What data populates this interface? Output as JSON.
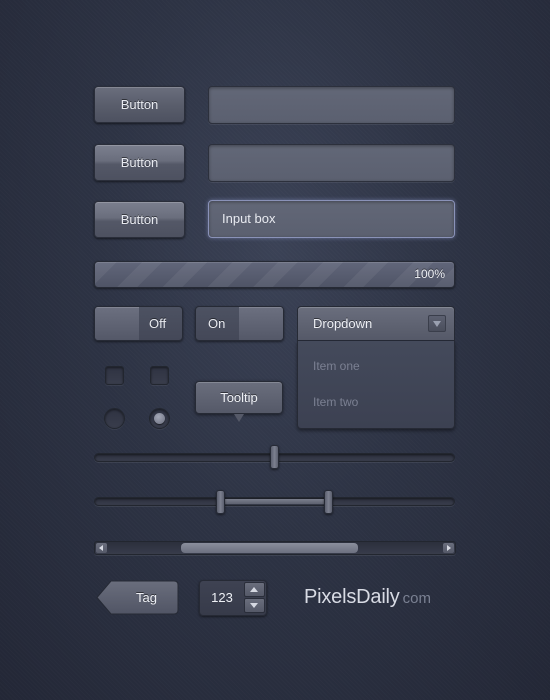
{
  "buttons": [
    {
      "label": "Button",
      "state": "normal"
    },
    {
      "label": "Button",
      "state": "hover"
    },
    {
      "label": "Button",
      "state": "pressed"
    }
  ],
  "inputs": [
    {
      "value": "",
      "state": "normal"
    },
    {
      "value": "",
      "state": "normal"
    },
    {
      "value": "Input box",
      "state": "focused"
    }
  ],
  "progress": {
    "value": 1.0,
    "label": "100%"
  },
  "toggles": {
    "off": {
      "label": "Off",
      "state": "off"
    },
    "on": {
      "label": "On",
      "state": "on"
    }
  },
  "dropdown": {
    "selected": "Dropdown",
    "items": [
      "Item one",
      "Item two"
    ]
  },
  "checkboxes": [
    {
      "checked": false
    },
    {
      "checked": false
    }
  ],
  "radios": [
    {
      "selected": false
    },
    {
      "selected": true
    }
  ],
  "tooltip": {
    "label": "Tooltip"
  },
  "slider": {
    "value": 0.5
  },
  "range_slider": {
    "low": 0.35,
    "high": 0.65
  },
  "scrollbar": {
    "start": 0.22,
    "end": 0.75
  },
  "tag": {
    "label": "Tag"
  },
  "stepper": {
    "value": "123"
  },
  "brand": {
    "name": "PixelsDaily",
    "suffix": "com"
  },
  "colors": {
    "background": "#2b3040",
    "control": "#5a5e6c",
    "text": "#e8eaf0",
    "focus_ring": "#8a92b8"
  }
}
